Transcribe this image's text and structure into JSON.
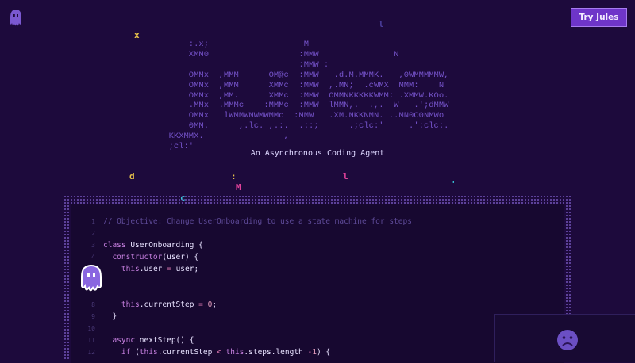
{
  "header": {
    "cta_label": "Try Jules"
  },
  "hero": {
    "ascii_lines": [
      "      :.x;                   M",
      "      XMM0                  :MMW               N",
      "                            :MMW :",
      "      OMMx  ,MMM      OM@c  :MMW   .d.M.MMMK.   ,0WMMMMMW,",
      "      OMMx  ,MMM      XMMc  :MMW  ,.MN;  .cWMX  MMM:    N",
      "      OMMx  ,MM.      XMMc  :MMW  OMMNKKKKKWMM: .XMMW.KOo.",
      "      .MMx  .MMMc    :MMMc  :MMW  lMMN,.  .,.  W   .';dMMW",
      "      OMMx   lWMMWNWMWMMc  :MMW   .XM.NKKNMN. ..MN0O0NMWo",
      "      0MM.      ,.lc. ,.:.  .::;      .;clc:'     .':clc:.",
      "  KKXMMX.                ,",
      "  ;cl:'"
    ],
    "tagline": "An Asynchronous Coding Agent",
    "scatter": [
      "x",
      "l",
      "M",
      "N",
      "N",
      "W",
      "d",
      ":",
      "l",
      "M",
      "c",
      "'"
    ]
  },
  "editor": {
    "lines": [
      {
        "n": "1",
        "text": "// Objective: Change UserOnboarding to use a state machine for steps"
      },
      {
        "n": "2",
        "text": ""
      },
      {
        "n": "3",
        "text": "class UserOnboarding {"
      },
      {
        "n": "4",
        "text": "  constructor(user) {"
      },
      {
        "n": "5",
        "text": "    this.user = user;"
      },
      {
        "n": "",
        "text": ""
      },
      {
        "n": "",
        "text": ""
      },
      {
        "n": "8",
        "text": "    this.currentStep = 0;"
      },
      {
        "n": "9",
        "text": "  }"
      },
      {
        "n": "10",
        "text": ""
      },
      {
        "n": "11",
        "text": "  async nextStep() {"
      },
      {
        "n": "12",
        "text": "    if (this.currentStep < this.steps.length -1) {"
      }
    ]
  },
  "colors": {
    "background": "#1d0a3c",
    "accent": "#6e35c9",
    "ascii": "#7452c8",
    "yellow": "#e8c24a",
    "pink": "#e0419a",
    "cyan": "#36c3d6"
  },
  "icons": {
    "logo": "jules-octopus-icon",
    "mascot": "jules-octopus-mascot-icon",
    "status": "sad-face-icon"
  }
}
